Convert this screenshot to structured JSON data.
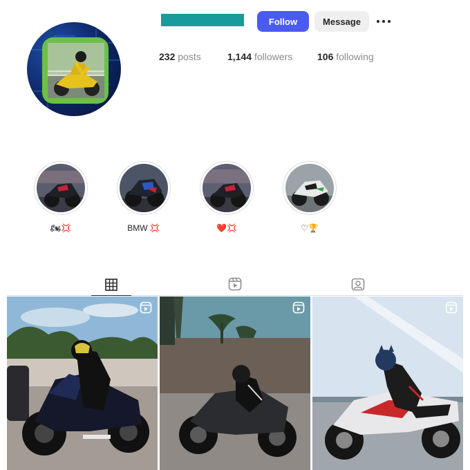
{
  "profile": {
    "follow_label": "Follow",
    "message_label": "Message",
    "more_icon": "more-horizontal-icon"
  },
  "stats": {
    "posts_count": "232",
    "posts_label": "posts",
    "followers_count": "1,144",
    "followers_label": "followers",
    "following_count": "106",
    "following_label": "following"
  },
  "highlights": [
    {
      "label": "🏍💢"
    },
    {
      "label": "BMW 💢"
    },
    {
      "label": "❤️💢"
    },
    {
      "label": "♡🏆"
    }
  ],
  "tabs": [
    {
      "name": "posts",
      "icon": "grid-icon",
      "active": true
    },
    {
      "name": "reels",
      "icon": "reels-icon",
      "active": false
    },
    {
      "name": "tagged",
      "icon": "tagged-icon",
      "active": false
    }
  ],
  "posts": [
    {
      "type": "reel",
      "icon": "reel-icon"
    },
    {
      "type": "reel",
      "icon": "reel-icon"
    },
    {
      "type": "reel",
      "icon": "reel-icon"
    }
  ],
  "colors": {
    "follow_button": "#4a5bf0",
    "username_redacted": "#1a9a9a",
    "avatar_frame": "#6cc04a"
  }
}
